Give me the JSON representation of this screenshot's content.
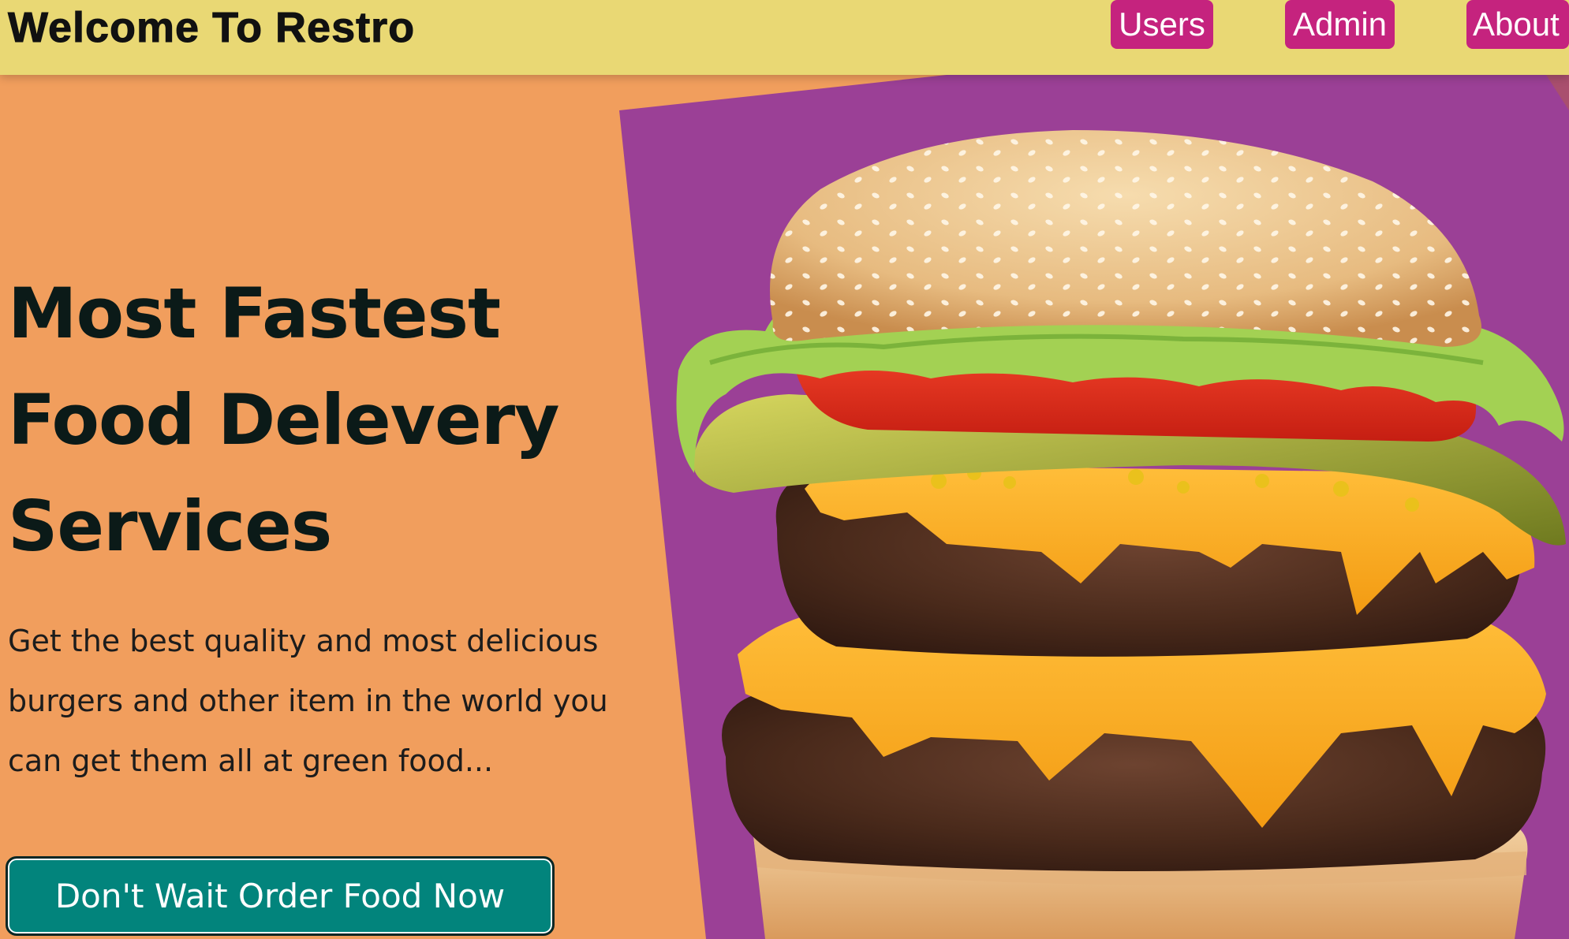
{
  "header": {
    "brand": "Welcome To Restro",
    "nav": [
      {
        "label": "Users"
      },
      {
        "label": "Admin"
      },
      {
        "label": "About"
      }
    ]
  },
  "hero": {
    "title_lines": [
      "Most Fastest",
      "Food Delevery",
      "Services"
    ],
    "text_lines": [
      "Get the best quality and most delicious",
      "burgers and other item in the world you",
      "can get them all at green food..."
    ],
    "cta_label": "Don't Wait Order Food Now"
  },
  "colors": {
    "background": "#f19e5d",
    "header": "#e9d874",
    "nav_button": "#c5237e",
    "panel": "#9b4096",
    "cta": "#02847c"
  },
  "image": {
    "subject": "burger-image"
  }
}
